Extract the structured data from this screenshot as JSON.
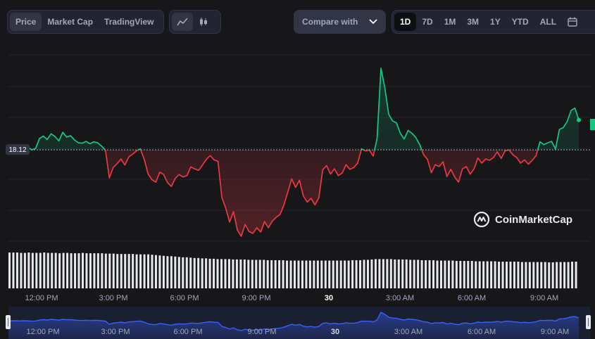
{
  "tabs": {
    "price": "Price",
    "market_cap": "Market Cap",
    "tradingview": "TradingView",
    "active": "Price"
  },
  "chart_type_icons": [
    "line-chart-icon",
    "candlestick-icon"
  ],
  "compare": {
    "label": "Compare with"
  },
  "ranges": [
    "1D",
    "7D",
    "1M",
    "3M",
    "1Y",
    "YTD",
    "ALL"
  ],
  "active_range": "1D",
  "calendar_icon": "calendar-icon",
  "brand": {
    "name": "CoinMarketCap"
  },
  "colors": {
    "up": "#16c784",
    "down": "#ea3943",
    "bg": "#17171a",
    "volume": "#e6e8ef",
    "mini_line": "#3861fb"
  },
  "chart_data": {
    "type": "line",
    "reference_price": 18.12,
    "reference_label": "18.12",
    "x_ticks": [
      "12:00 PM",
      "3:00 PM",
      "6:00 PM",
      "9:00 PM",
      "30",
      "3:00 AM",
      "6:00 AM",
      "9:00 AM"
    ],
    "x_ticks_bold": "30",
    "grid": true,
    "price": [
      18.14,
      18.19,
      18.2,
      18.17,
      18.22,
      18.18,
      18.12,
      18.15,
      18.36,
      18.41,
      18.34,
      18.46,
      18.4,
      18.31,
      18.49,
      18.39,
      18.42,
      18.33,
      18.27,
      18.26,
      18.3,
      18.25,
      18.29,
      18.27,
      18.2,
      18.11,
      17.53,
      17.75,
      17.83,
      17.93,
      17.8,
      17.97,
      18.03,
      18.1,
      18.14,
      17.92,
      17.61,
      17.49,
      17.44,
      17.65,
      17.6,
      17.43,
      17.35,
      17.52,
      17.6,
      17.55,
      17.58,
      17.76,
      17.72,
      17.69,
      17.8,
      17.92,
      18.0,
      17.91,
      17.88,
      17.12,
      16.89,
      16.6,
      16.82,
      16.43,
      16.3,
      16.55,
      16.4,
      16.36,
      16.48,
      16.39,
      16.61,
      16.48,
      16.62,
      16.7,
      16.76,
      16.96,
      17.23,
      17.51,
      17.33,
      17.48,
      17.15,
      17.02,
      17.1,
      16.96,
      17.11,
      17.7,
      17.79,
      17.61,
      17.72,
      17.58,
      17.63,
      17.81,
      17.71,
      17.75,
      17.84,
      18.14,
      18.1,
      18.12,
      17.99,
      18.36,
      19.84,
      19.43,
      18.87,
      18.73,
      18.69,
      18.47,
      18.35,
      18.53,
      18.47,
      18.38,
      18.23,
      18.02,
      17.92,
      17.64,
      17.81,
      17.77,
      17.87,
      17.56,
      17.71,
      17.55,
      17.44,
      17.72,
      17.77,
      17.61,
      17.72,
      17.95,
      17.84,
      17.93,
      17.9,
      17.96,
      18.08,
      17.94,
      18.1,
      18.12,
      18.02,
      17.96,
      17.84,
      17.91,
      17.82,
      17.9,
      18.0,
      18.29,
      18.23,
      18.27,
      18.3,
      18.14,
      18.55,
      18.59,
      18.72,
      18.95,
      19.0,
      18.75
    ],
    "volume_relative": [
      0.98,
      0.98,
      0.98,
      0.97,
      0.97,
      0.98,
      0.97,
      0.97,
      0.97,
      0.98,
      0.97,
      0.97,
      0.97,
      0.96,
      0.97,
      0.97,
      0.96,
      0.96,
      0.96,
      0.97,
      0.96,
      0.96,
      0.96,
      0.96,
      0.96,
      0.95,
      0.95,
      0.95,
      0.94,
      0.94,
      0.94,
      0.94,
      0.94,
      0.93,
      0.93,
      0.93,
      0.93,
      0.92,
      0.91,
      0.9,
      0.89,
      0.88,
      0.88,
      0.87,
      0.86,
      0.85,
      0.85,
      0.84,
      0.83,
      0.83,
      0.82,
      0.82,
      0.81,
      0.81,
      0.8,
      0.8,
      0.8,
      0.8,
      0.79,
      0.79,
      0.79,
      0.79,
      0.78,
      0.78,
      0.78,
      0.78,
      0.78,
      0.77,
      0.77,
      0.77,
      0.77,
      0.77,
      0.76,
      0.76,
      0.76,
      0.76,
      0.76,
      0.76,
      0.76,
      0.76,
      0.76,
      0.76,
      0.76,
      0.76,
      0.76,
      0.76,
      0.76,
      0.76,
      0.76,
      0.77,
      0.77,
      0.77,
      0.78,
      0.78,
      0.79,
      0.8,
      0.8,
      0.8,
      0.8,
      0.8,
      0.79,
      0.79,
      0.79,
      0.79,
      0.78,
      0.78,
      0.78,
      0.77,
      0.77,
      0.77,
      0.77,
      0.76,
      0.76,
      0.76,
      0.76,
      0.76,
      0.75,
      0.75,
      0.75,
      0.75,
      0.75,
      0.74,
      0.74,
      0.74,
      0.74,
      0.74,
      0.74,
      0.73,
      0.73,
      0.73,
      0.73,
      0.73,
      0.73,
      0.72,
      0.72,
      0.72,
      0.72,
      0.72,
      0.72,
      0.72,
      0.71,
      0.71,
      0.72,
      0.72,
      0.72,
      0.72,
      0.73,
      0.73
    ],
    "overview_ticks": [
      "12:00 PM",
      "3:00 PM",
      "6:00 PM",
      "9:00 PM",
      "30",
      "3:00 AM",
      "6:00 AM",
      "9:00 AM"
    ]
  }
}
